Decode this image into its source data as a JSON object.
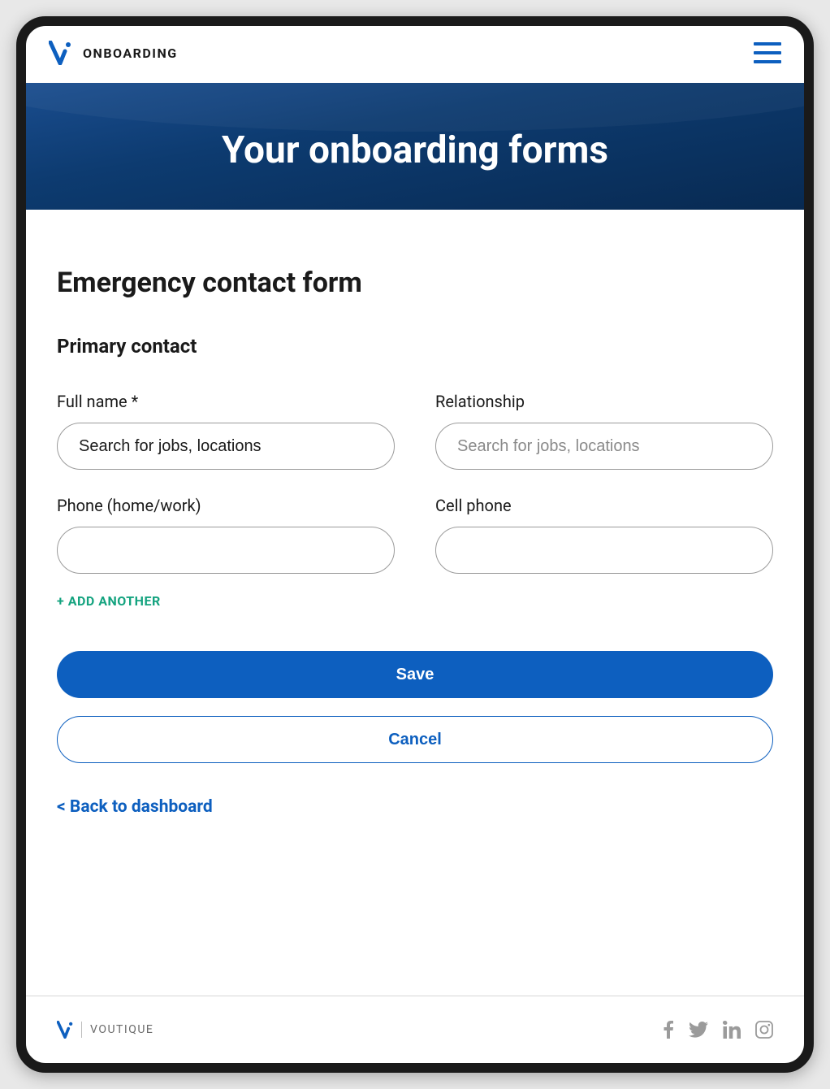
{
  "header": {
    "title": "ONBOARDING"
  },
  "hero": {
    "title": "Your onboarding forms"
  },
  "form": {
    "title": "Emergency contact form",
    "section_title": "Primary contact",
    "fields": {
      "full_name": {
        "label": "Full name *",
        "value": "Search for jobs, locations",
        "placeholder": ""
      },
      "relationship": {
        "label": "Relationship",
        "value": "",
        "placeholder": "Search for jobs, locations"
      },
      "phone_home_work": {
        "label": "Phone (home/work)",
        "value": "",
        "placeholder": ""
      },
      "cell_phone": {
        "label": "Cell phone",
        "value": "",
        "placeholder": ""
      }
    },
    "add_another_label": "+ ADD ANOTHER",
    "actions": {
      "save_label": "Save",
      "cancel_label": "Cancel"
    },
    "back_link_label": "< Back to dashboard"
  },
  "footer": {
    "brand": "VOUTIQUE"
  },
  "colors": {
    "primary": "#0d5fbf",
    "accent_green": "#14a37f",
    "hero_dark": "#082a52"
  }
}
